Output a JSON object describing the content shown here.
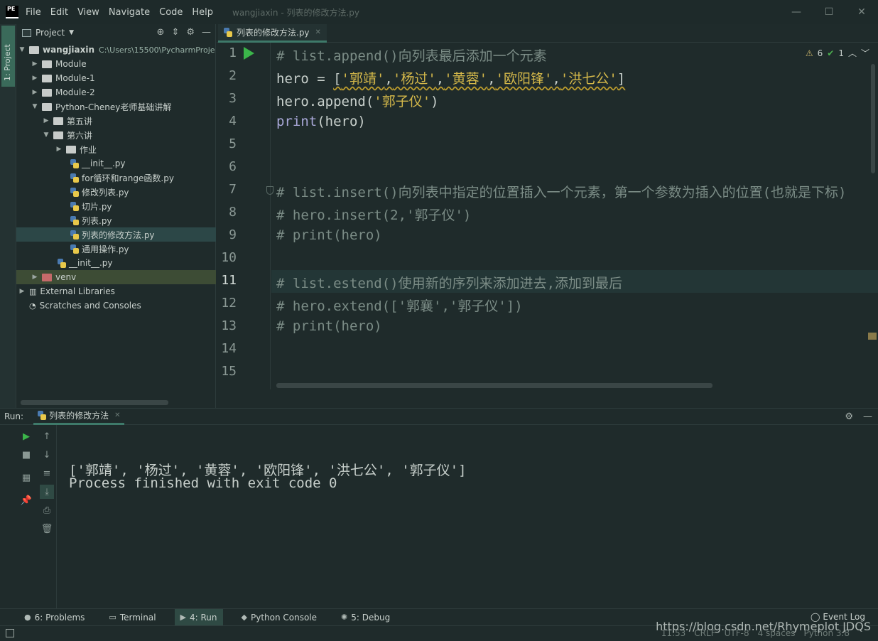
{
  "window": {
    "title": "wangjiaxin - 列表的修改方法.py",
    "logo_text": "PE",
    "controls": [
      "—",
      "☐",
      "✕"
    ]
  },
  "menu": [
    {
      "label": "File"
    },
    {
      "label": "Edit"
    },
    {
      "label": "View"
    },
    {
      "label": "Navigate"
    },
    {
      "label": "Code"
    },
    {
      "label": "Help"
    }
  ],
  "left_stripe": {
    "project_tab": "1: Project"
  },
  "project_panel": {
    "title": "Project",
    "root_name": "wangjiaxin",
    "root_path": "C:\\Users\\15500\\PycharmProje",
    "items": [
      {
        "label": "Module",
        "kind": "folder",
        "depth": 1
      },
      {
        "label": "Module-1",
        "kind": "folder",
        "depth": 1
      },
      {
        "label": "Module-2",
        "kind": "folder",
        "depth": 1
      },
      {
        "label": "Python-Cheney老师基础讲解",
        "kind": "folder-open",
        "depth": 1
      },
      {
        "label": "第五讲",
        "kind": "folder",
        "depth": 2
      },
      {
        "label": "第六讲",
        "kind": "folder-open",
        "depth": 2
      },
      {
        "label": "作业",
        "kind": "folder",
        "depth": 3
      },
      {
        "label": "__init__.py",
        "kind": "py",
        "depth": 4
      },
      {
        "label": "for循环和range函数.py",
        "kind": "py",
        "depth": 4
      },
      {
        "label": "修改列表.py",
        "kind": "py",
        "depth": 4
      },
      {
        "label": "切片.py",
        "kind": "py",
        "depth": 4
      },
      {
        "label": "列表.py",
        "kind": "py",
        "depth": 4
      },
      {
        "label": "列表的修改方法.py",
        "kind": "py",
        "depth": 4,
        "selected": true
      },
      {
        "label": "通用操作.py",
        "kind": "py",
        "depth": 4
      },
      {
        "label": "__init__.py",
        "kind": "py",
        "depth": 3
      },
      {
        "label": "venv",
        "kind": "folder-red",
        "depth": 1,
        "highlight": true
      },
      {
        "label": "External Libraries",
        "kind": "lib",
        "depth": 0
      },
      {
        "label": "Scratches and Consoles",
        "kind": "scratch",
        "depth": 0
      }
    ]
  },
  "editor": {
    "tab_label": "列表的修改方法.py",
    "inspections": {
      "warnings": "6",
      "ok": "1"
    },
    "line_numbers": [
      "1",
      "2",
      "3",
      "4",
      "5",
      "6",
      "7",
      "8",
      "9",
      "10",
      "11",
      "12",
      "13",
      "14",
      "15"
    ],
    "current_line": "11",
    "lines": [
      "# list.append()向列表最后添加一个元素",
      "hero = ['郭靖','杨过','黄蓉','欧阳锋','洪七公']",
      "hero.append('郭子仪')",
      "print(hero)",
      "",
      "",
      "# list.insert()向列表中指定的位置插入一个元素，第一个参数为插入的位置(也就是下标)",
      "# hero.insert(2,'郭子仪')",
      "# print(hero)",
      "",
      "# list.estend()使用新的序列来添加进去,添加到最后",
      "# hero.extend(['郭襄','郭子仪'])",
      "# print(hero)",
      "",
      ""
    ]
  },
  "run_panel": {
    "label": "Run:",
    "tab_label": "列表的修改方法",
    "output_line_1": "['郭靖', '杨过', '黄蓉', '欧阳锋', '洪七公', '郭子仪']",
    "output_line_2": "Process finished with exit code 0"
  },
  "bottom_tools": [
    {
      "label": "6: Problems",
      "icon": "problems-icon"
    },
    {
      "label": "Terminal",
      "icon": "terminal-icon"
    },
    {
      "label": "4: Run",
      "icon": "run-icon",
      "active": true
    },
    {
      "label": "Python Console",
      "icon": "python-console-icon"
    },
    {
      "label": "5: Debug",
      "icon": "debug-icon"
    }
  ],
  "event_log": "Event Log",
  "status_bar": {
    "position": "11:53",
    "line_sep": "CRLF",
    "encoding": "UTF-8",
    "indent": "4 spaces",
    "interpreter": "Python 3.8"
  },
  "watermark": "https://blog.csdn.net/Rhymeplot   JDQS",
  "colors": {
    "background": "#1f2b2b",
    "comment": "#7b8c86",
    "string": "#d4b84a",
    "builtin": "#a9a8d8",
    "run_green": "#3bb54a",
    "accent": "#3e7a6a"
  }
}
